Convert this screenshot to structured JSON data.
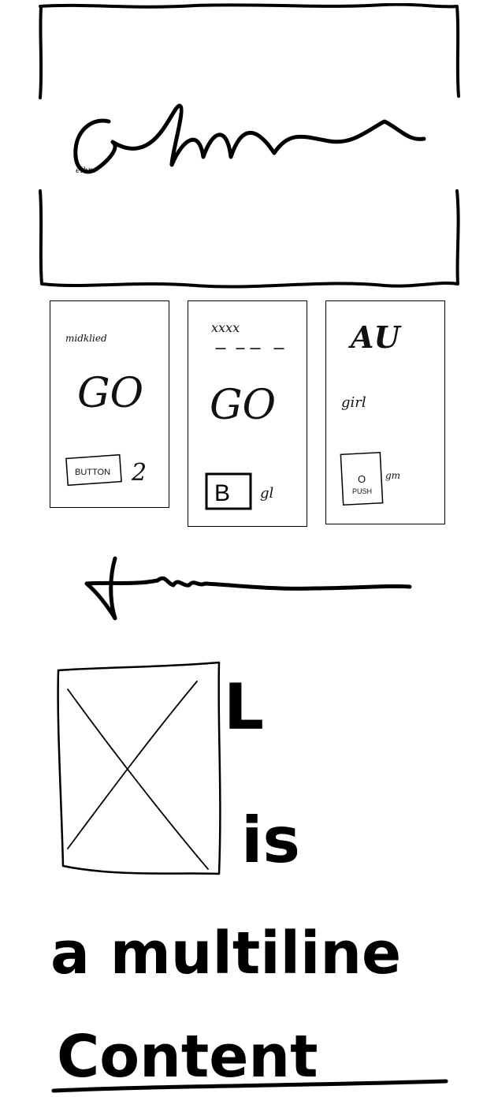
{
  "hero": {
    "heading": "elhn"
  },
  "cards": [
    {
      "top_text": "midklied",
      "big_label": "GO",
      "button_label": "BUTTON",
      "side_text": "2"
    },
    {
      "top_text": "xxxx",
      "big_label": "GO",
      "button_label": "B",
      "side_text": "gl"
    },
    {
      "top_text": "AU",
      "middle_text": "girl",
      "button_mark": "O",
      "button_label": "PUSH",
      "side_text": "gm"
    }
  ],
  "content": {
    "line_1": "L",
    "line_2": "is",
    "line_3": "a multiline",
    "line_4": "Content"
  }
}
